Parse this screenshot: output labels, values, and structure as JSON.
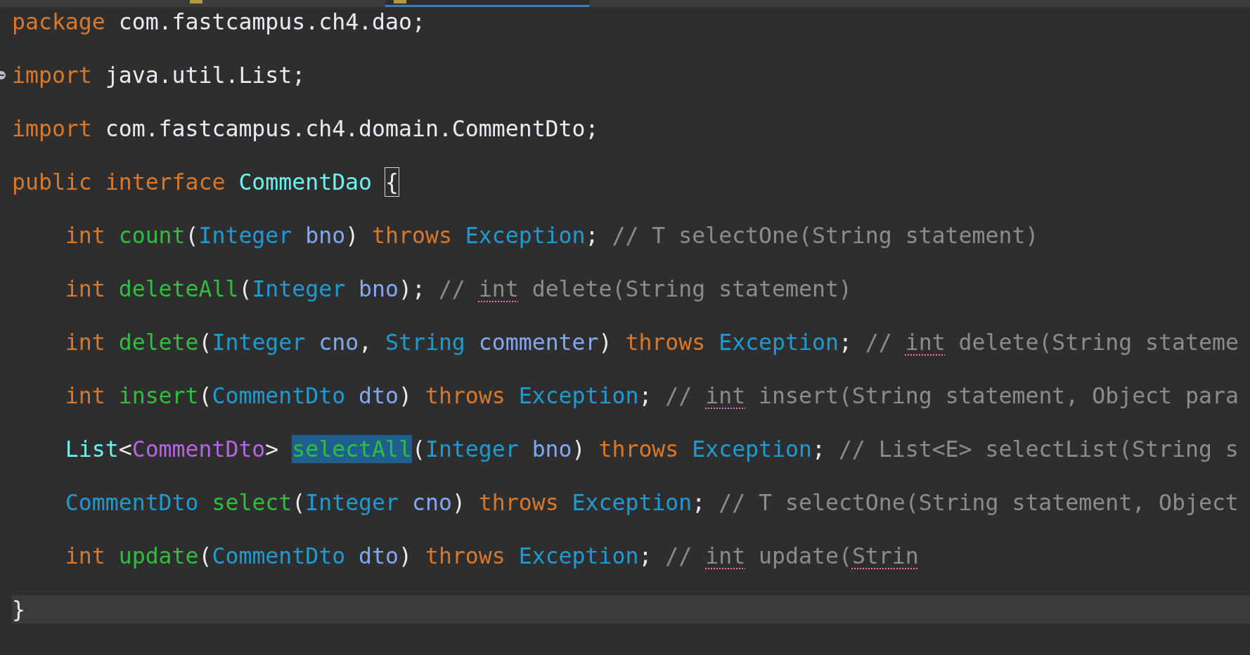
{
  "tabs": [
    {
      "selected": false
    },
    {
      "selected": true
    }
  ],
  "lines": [
    {
      "current": false,
      "fold": false,
      "tokens": [
        {
          "text": "package",
          "kind": "keyword"
        },
        {
          "text": " com.fastcampus.ch4.dao;",
          "kind": "plain"
        }
      ]
    },
    {
      "current": false,
      "fold": true,
      "tokens": [
        {
          "text": "import",
          "kind": "keyword"
        },
        {
          "text": " java.util.List;",
          "kind": "plain"
        }
      ]
    },
    {
      "current": false,
      "fold": false,
      "tokens": [
        {
          "text": "import",
          "kind": "keyword"
        },
        {
          "text": " com.fastcampus.ch4.domain.CommentDto;",
          "kind": "plain"
        }
      ]
    },
    {
      "current": false,
      "fold": false,
      "tokens": [
        {
          "text": "public interface ",
          "kind": "keyword"
        },
        {
          "text": "CommentDao ",
          "kind": "declared"
        },
        {
          "text": "{",
          "kind": "plain",
          "matched": true
        }
      ]
    },
    {
      "current": false,
      "fold": false,
      "tokens": [
        {
          "text": "    int ",
          "kind": "keyword"
        },
        {
          "text": "count",
          "kind": "method"
        },
        {
          "text": "(",
          "kind": "plain"
        },
        {
          "text": "Integer ",
          "kind": "type"
        },
        {
          "text": "bno",
          "kind": "param"
        },
        {
          "text": ") ",
          "kind": "plain"
        },
        {
          "text": "throws ",
          "kind": "keyword"
        },
        {
          "text": "Exception",
          "kind": "type"
        },
        {
          "text": "; ",
          "kind": "plain"
        },
        {
          "text": "// T selectOne(String statement)",
          "kind": "comment"
        }
      ]
    },
    {
      "current": false,
      "fold": false,
      "tokens": [
        {
          "text": "    int ",
          "kind": "keyword"
        },
        {
          "text": "deleteAll",
          "kind": "method"
        },
        {
          "text": "(",
          "kind": "plain"
        },
        {
          "text": "Integer ",
          "kind": "type"
        },
        {
          "text": "bno",
          "kind": "param"
        },
        {
          "text": "); ",
          "kind": "plain"
        },
        {
          "text": "// ",
          "kind": "comment"
        },
        {
          "text": "int",
          "kind": "comment",
          "spell_error": true
        },
        {
          "text": " delete(String statement)",
          "kind": "comment"
        }
      ]
    },
    {
      "current": false,
      "fold": false,
      "tokens": [
        {
          "text": "    int ",
          "kind": "keyword"
        },
        {
          "text": "delete",
          "kind": "method"
        },
        {
          "text": "(",
          "kind": "plain"
        },
        {
          "text": "Integer ",
          "kind": "type"
        },
        {
          "text": "cno",
          "kind": "param"
        },
        {
          "text": ", ",
          "kind": "plain"
        },
        {
          "text": "String ",
          "kind": "type"
        },
        {
          "text": "commenter",
          "kind": "param"
        },
        {
          "text": ") ",
          "kind": "plain"
        },
        {
          "text": "throws ",
          "kind": "keyword"
        },
        {
          "text": "Exception",
          "kind": "type"
        },
        {
          "text": "; ",
          "kind": "plain"
        },
        {
          "text": "// ",
          "kind": "comment"
        },
        {
          "text": "int",
          "kind": "comment",
          "spell_error": true
        },
        {
          "text": " delete(String stateme",
          "kind": "comment"
        }
      ]
    },
    {
      "current": false,
      "fold": false,
      "tokens": [
        {
          "text": "    int ",
          "kind": "keyword"
        },
        {
          "text": "insert",
          "kind": "method"
        },
        {
          "text": "(",
          "kind": "plain"
        },
        {
          "text": "CommentDto ",
          "kind": "type"
        },
        {
          "text": "dto",
          "kind": "param"
        },
        {
          "text": ") ",
          "kind": "plain"
        },
        {
          "text": "throws ",
          "kind": "keyword"
        },
        {
          "text": "Exception",
          "kind": "type"
        },
        {
          "text": "; ",
          "kind": "plain"
        },
        {
          "text": "// ",
          "kind": "comment"
        },
        {
          "text": "int",
          "kind": "comment",
          "spell_error": true
        },
        {
          "text": " insert(String statement, Object para",
          "kind": "comment"
        }
      ]
    },
    {
      "current": false,
      "fold": false,
      "tokens": [
        {
          "text": "    List",
          "kind": "declared"
        },
        {
          "text": "<",
          "kind": "plain"
        },
        {
          "text": "CommentDto",
          "kind": "generic"
        },
        {
          "text": "> ",
          "kind": "plain"
        },
        {
          "text": "selectAll",
          "kind": "method",
          "selected": true
        },
        {
          "text": "(",
          "kind": "plain"
        },
        {
          "text": "Integer ",
          "kind": "type"
        },
        {
          "text": "bno",
          "kind": "param"
        },
        {
          "text": ") ",
          "kind": "plain"
        },
        {
          "text": "throws ",
          "kind": "keyword"
        },
        {
          "text": "Exception",
          "kind": "type"
        },
        {
          "text": "; ",
          "kind": "plain"
        },
        {
          "text": "// List<E> selectList(String s",
          "kind": "comment"
        }
      ]
    },
    {
      "current": false,
      "fold": false,
      "tokens": [
        {
          "text": "    CommentDto ",
          "kind": "type"
        },
        {
          "text": "select",
          "kind": "method"
        },
        {
          "text": "(",
          "kind": "plain"
        },
        {
          "text": "Integer ",
          "kind": "type"
        },
        {
          "text": "cno",
          "kind": "param"
        },
        {
          "text": ") ",
          "kind": "plain"
        },
        {
          "text": "throws ",
          "kind": "keyword"
        },
        {
          "text": "Exception",
          "kind": "type"
        },
        {
          "text": "; ",
          "kind": "plain"
        },
        {
          "text": "// T selectOne(String statement, Object",
          "kind": "comment"
        }
      ]
    },
    {
      "current": false,
      "fold": false,
      "tokens": [
        {
          "text": "    int ",
          "kind": "keyword"
        },
        {
          "text": "update",
          "kind": "method"
        },
        {
          "text": "(",
          "kind": "plain"
        },
        {
          "text": "CommentDto ",
          "kind": "type"
        },
        {
          "text": "dto",
          "kind": "param"
        },
        {
          "text": ") ",
          "kind": "plain"
        },
        {
          "text": "throws ",
          "kind": "keyword"
        },
        {
          "text": "Exception",
          "kind": "type"
        },
        {
          "text": "; ",
          "kind": "plain"
        },
        {
          "text": "// ",
          "kind": "comment"
        },
        {
          "text": "int",
          "kind": "comment",
          "spell_error": true
        },
        {
          "text": " update(",
          "kind": "comment"
        },
        {
          "text": "Strin",
          "kind": "comment",
          "spell_error": true
        }
      ]
    },
    {
      "current": true,
      "fold": false,
      "tokens": [
        {
          "text": "}",
          "kind": "plain"
        }
      ]
    }
  ]
}
